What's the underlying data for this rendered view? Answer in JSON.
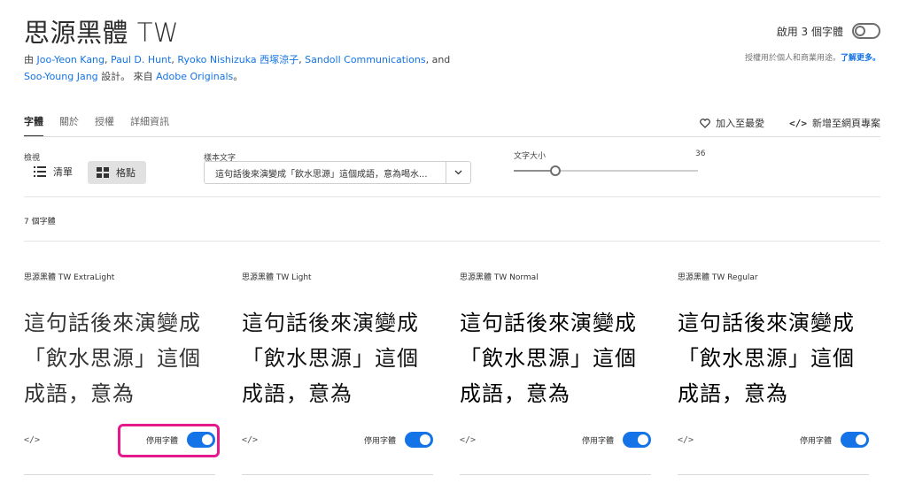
{
  "header": {
    "title": "思源黑體 TW",
    "credits_prefix": "由",
    "designers": [
      "Joo-Yeon Kang",
      "Paul D. Hunt",
      "Ryoko Nishizuka 西塚涼子",
      "Sandoll Communications"
    ],
    "credits_and": "and",
    "designer_last": "Soo-Young Jang",
    "credits_design": "設計。 來自",
    "foundry": "Adobe Originals",
    "credits_end": "。",
    "activate_all_label": "啟用 3 個字體",
    "license_text": "授權用於個人和商業用途。",
    "license_more": "了解更多。"
  },
  "tabs": [
    {
      "label": "字體",
      "active": true
    },
    {
      "label": "關於",
      "active": false
    },
    {
      "label": "授權",
      "active": false
    },
    {
      "label": "詳細資訊",
      "active": false
    }
  ],
  "actions": {
    "favorite": "加入至最愛",
    "web_project": "新增至網頁專案"
  },
  "controls": {
    "view_label": "檢視",
    "view_list": "清單",
    "view_grid": "格點",
    "view_selected": "格點",
    "sample_label": "樣本文字",
    "sample_value": "這句話後來演變成「飲水思源」這個成語，意為喝水...",
    "size_label": "文字大小",
    "size_value": "36"
  },
  "count_label": "7 個字體",
  "fonts": [
    {
      "name": "思源黑體 TW ExtraLight",
      "weight": 200,
      "active": true
    },
    {
      "name": "思源黑體 TW Light",
      "weight": 300,
      "active": true
    },
    {
      "name": "思源黑體 TW Normal",
      "weight": 400,
      "active": true
    },
    {
      "name": "思源黑體 TW Regular",
      "weight": 500,
      "active": true
    }
  ],
  "card_sample": "這句話後來演變成「飲水思源」這個成語，意為",
  "card_code_label": "</>",
  "card_deactivate_label": "停用字體",
  "colors": {
    "accent": "#1473e6",
    "highlight": "#e6198c"
  }
}
